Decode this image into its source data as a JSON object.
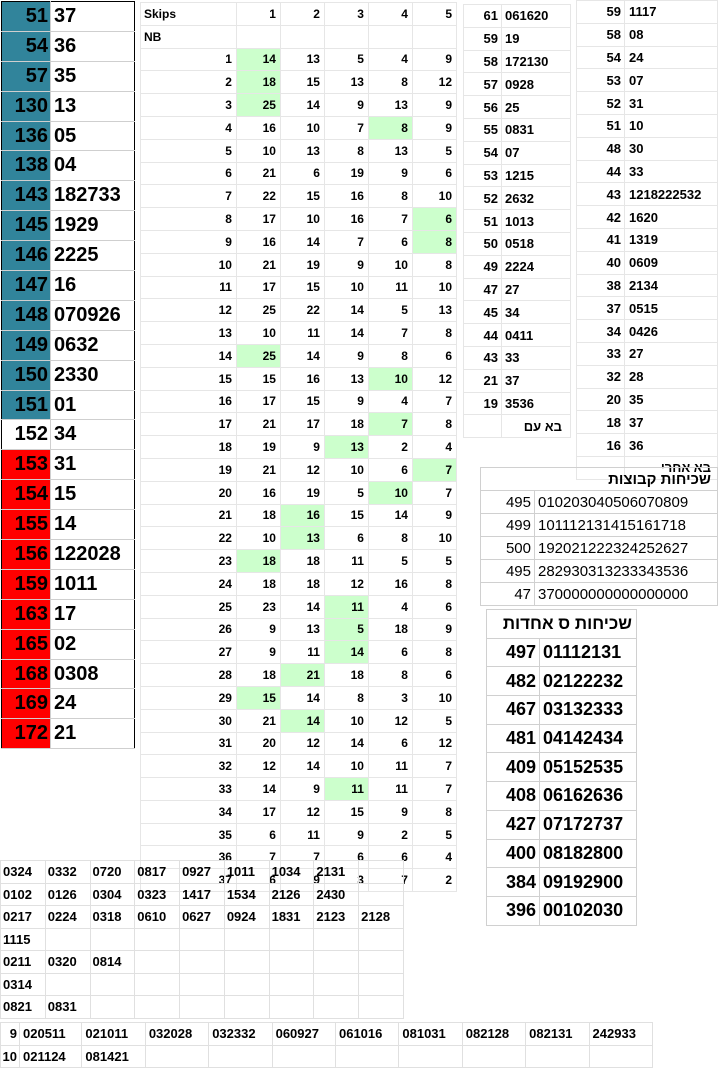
{
  "left_panel": [
    {
      "n": "51",
      "v": "37",
      "c": "blue"
    },
    {
      "n": "54",
      "v": "36",
      "c": "blue"
    },
    {
      "n": "57",
      "v": "35",
      "c": "blue"
    },
    {
      "n": "130",
      "v": "13",
      "c": "blue"
    },
    {
      "n": "136",
      "v": "05",
      "c": "blue"
    },
    {
      "n": "138",
      "v": "04",
      "c": "blue"
    },
    {
      "n": "143",
      "v": "182733",
      "c": "blue"
    },
    {
      "n": "145",
      "v": "1929",
      "c": "blue"
    },
    {
      "n": "146",
      "v": "2225",
      "c": "blue"
    },
    {
      "n": "147",
      "v": "16",
      "c": "blue"
    },
    {
      "n": "148",
      "v": "070926",
      "c": "blue"
    },
    {
      "n": "149",
      "v": "0632",
      "c": "blue"
    },
    {
      "n": "150",
      "v": "2330",
      "c": "blue"
    },
    {
      "n": "151",
      "v": "01",
      "c": "blue"
    },
    {
      "n": "152",
      "v": "34",
      "c": "white"
    },
    {
      "n": "153",
      "v": "31",
      "c": "red"
    },
    {
      "n": "154",
      "v": "15",
      "c": "red"
    },
    {
      "n": "155",
      "v": "14",
      "c": "red"
    },
    {
      "n": "156",
      "v": "122028",
      "c": "red"
    },
    {
      "n": "159",
      "v": "1011",
      "c": "red"
    },
    {
      "n": "163",
      "v": "17",
      "c": "red"
    },
    {
      "n": "165",
      "v": "02",
      "c": "red"
    },
    {
      "n": "168",
      "v": "0308",
      "c": "red"
    },
    {
      "n": "169",
      "v": "24",
      "c": "red"
    },
    {
      "n": "172",
      "v": "21",
      "c": "red"
    }
  ],
  "skips": {
    "header_label": "Skips",
    "nb_label": "NB",
    "columns": [
      "1",
      "2",
      "3",
      "4",
      "5"
    ],
    "rows": [
      {
        "n": "1",
        "v": [
          "14",
          "13",
          "5",
          "4",
          "9"
        ],
        "hl": [
          0
        ]
      },
      {
        "n": "2",
        "v": [
          "18",
          "15",
          "13",
          "8",
          "12"
        ],
        "hl": [
          0
        ]
      },
      {
        "n": "3",
        "v": [
          "25",
          "14",
          "9",
          "13",
          "9"
        ],
        "hl": [
          0
        ]
      },
      {
        "n": "4",
        "v": [
          "16",
          "10",
          "7",
          "8",
          "9"
        ],
        "hl": [
          3
        ]
      },
      {
        "n": "5",
        "v": [
          "10",
          "13",
          "8",
          "13",
          "5"
        ],
        "hl": []
      },
      {
        "n": "6",
        "v": [
          "21",
          "6",
          "19",
          "9",
          "6"
        ],
        "hl": []
      },
      {
        "n": "7",
        "v": [
          "22",
          "15",
          "16",
          "8",
          "10"
        ],
        "hl": []
      },
      {
        "n": "8",
        "v": [
          "17",
          "10",
          "16",
          "7",
          "6"
        ],
        "hl": [
          4
        ]
      },
      {
        "n": "9",
        "v": [
          "16",
          "14",
          "7",
          "6",
          "8"
        ],
        "hl": [
          4
        ]
      },
      {
        "n": "10",
        "v": [
          "21",
          "19",
          "9",
          "10",
          "8"
        ],
        "hl": []
      },
      {
        "n": "11",
        "v": [
          "17",
          "15",
          "10",
          "11",
          "10"
        ],
        "hl": []
      },
      {
        "n": "12",
        "v": [
          "25",
          "22",
          "14",
          "5",
          "13"
        ],
        "hl": []
      },
      {
        "n": "13",
        "v": [
          "10",
          "11",
          "14",
          "7",
          "8"
        ],
        "hl": []
      },
      {
        "n": "14",
        "v": [
          "25",
          "14",
          "9",
          "8",
          "6"
        ],
        "hl": [
          0
        ]
      },
      {
        "n": "15",
        "v": [
          "15",
          "16",
          "13",
          "10",
          "12"
        ],
        "hl": [
          3
        ]
      },
      {
        "n": "16",
        "v": [
          "17",
          "15",
          "9",
          "4",
          "7"
        ],
        "hl": []
      },
      {
        "n": "17",
        "v": [
          "21",
          "17",
          "18",
          "7",
          "8"
        ],
        "hl": [
          3
        ]
      },
      {
        "n": "18",
        "v": [
          "19",
          "9",
          "13",
          "2",
          "4"
        ],
        "hl": [
          2
        ]
      },
      {
        "n": "19",
        "v": [
          "21",
          "12",
          "10",
          "6",
          "7"
        ],
        "hl": [
          4
        ]
      },
      {
        "n": "20",
        "v": [
          "16",
          "19",
          "5",
          "10",
          "7"
        ],
        "hl": [
          3
        ]
      },
      {
        "n": "21",
        "v": [
          "18",
          "16",
          "15",
          "14",
          "9"
        ],
        "hl": [
          1
        ]
      },
      {
        "n": "22",
        "v": [
          "10",
          "13",
          "6",
          "8",
          "10"
        ],
        "hl": [
          1
        ]
      },
      {
        "n": "23",
        "v": [
          "18",
          "18",
          "11",
          "5",
          "5"
        ],
        "hl": [
          0
        ]
      },
      {
        "n": "24",
        "v": [
          "18",
          "18",
          "12",
          "16",
          "8"
        ],
        "hl": []
      },
      {
        "n": "25",
        "v": [
          "23",
          "14",
          "11",
          "4",
          "6"
        ],
        "hl": [
          2
        ]
      },
      {
        "n": "26",
        "v": [
          "9",
          "13",
          "5",
          "18",
          "9"
        ],
        "hl": [
          2
        ]
      },
      {
        "n": "27",
        "v": [
          "9",
          "11",
          "14",
          "6",
          "8"
        ],
        "hl": [
          2
        ]
      },
      {
        "n": "28",
        "v": [
          "18",
          "21",
          "18",
          "8",
          "6"
        ],
        "hl": [
          1
        ]
      },
      {
        "n": "29",
        "v": [
          "15",
          "14",
          "8",
          "3",
          "10"
        ],
        "hl": [
          0
        ]
      },
      {
        "n": "30",
        "v": [
          "21",
          "14",
          "10",
          "12",
          "5"
        ],
        "hl": [
          1
        ]
      },
      {
        "n": "31",
        "v": [
          "20",
          "12",
          "14",
          "6",
          "12"
        ],
        "hl": []
      },
      {
        "n": "32",
        "v": [
          "12",
          "14",
          "10",
          "11",
          "7"
        ],
        "hl": []
      },
      {
        "n": "33",
        "v": [
          "14",
          "9",
          "11",
          "11",
          "7"
        ],
        "hl": [
          2
        ]
      },
      {
        "n": "34",
        "v": [
          "17",
          "12",
          "15",
          "9",
          "8"
        ],
        "hl": []
      },
      {
        "n": "35",
        "v": [
          "6",
          "11",
          "9",
          "2",
          "5"
        ],
        "hl": []
      },
      {
        "n": "36",
        "v": [
          "7",
          "7",
          "6",
          "6",
          "4"
        ],
        "hl": []
      },
      {
        "n": "37",
        "v": [
          "6",
          "9",
          "3",
          "7",
          "2"
        ],
        "hl": []
      }
    ]
  },
  "ba_im": {
    "rows": [
      {
        "n": "61",
        "v": "061620"
      },
      {
        "n": "59",
        "v": "19"
      },
      {
        "n": "58",
        "v": "172130"
      },
      {
        "n": "57",
        "v": "0928"
      },
      {
        "n": "56",
        "v": "25"
      },
      {
        "n": "55",
        "v": "0831"
      },
      {
        "n": "54",
        "v": "07"
      },
      {
        "n": "53",
        "v": "1215"
      },
      {
        "n": "52",
        "v": "2632"
      },
      {
        "n": "51",
        "v": "1013"
      },
      {
        "n": "50",
        "v": "0518"
      },
      {
        "n": "49",
        "v": "2224"
      },
      {
        "n": "47",
        "v": "27"
      },
      {
        "n": "45",
        "v": "34"
      },
      {
        "n": "44",
        "v": "0411"
      },
      {
        "n": "43",
        "v": "33"
      },
      {
        "n": "21",
        "v": "37"
      },
      {
        "n": "19",
        "v": "3536"
      }
    ],
    "label": "בא עם"
  },
  "ba_ahrei": {
    "rows": [
      {
        "n": "59",
        "v": "1117"
      },
      {
        "n": "58",
        "v": "08"
      },
      {
        "n": "54",
        "v": "24"
      },
      {
        "n": "53",
        "v": "07"
      },
      {
        "n": "52",
        "v": "31"
      },
      {
        "n": "51",
        "v": "10"
      },
      {
        "n": "48",
        "v": "30"
      },
      {
        "n": "44",
        "v": "33"
      },
      {
        "n": "43",
        "v": "1218222532"
      },
      {
        "n": "42",
        "v": "1620"
      },
      {
        "n": "41",
        "v": "1319"
      },
      {
        "n": "40",
        "v": "0609"
      },
      {
        "n": "38",
        "v": "2134"
      },
      {
        "n": "37",
        "v": "0515"
      },
      {
        "n": "34",
        "v": "0426"
      },
      {
        "n": "33",
        "v": "27"
      },
      {
        "n": "32",
        "v": "28"
      },
      {
        "n": "20",
        "v": "35"
      },
      {
        "n": "18",
        "v": "37"
      },
      {
        "n": "16",
        "v": "36"
      }
    ],
    "label": "בא אחרי"
  },
  "shchihut_kvutzot": {
    "title": "שכיחות קבוצות",
    "rows": [
      {
        "n": "495",
        "v": "010203040506070809"
      },
      {
        "n": "499",
        "v": "101112131415161718"
      },
      {
        "n": "500",
        "v": "192021222324252627"
      },
      {
        "n": "495",
        "v": "282930313233343536"
      },
      {
        "n": "47",
        "v": "370000000000000000"
      }
    ]
  },
  "shchihut_ahadot": {
    "title": "שכיחות ס אחדות",
    "rows": [
      {
        "n": "497",
        "v": "01112131"
      },
      {
        "n": "482",
        "v": "02122232"
      },
      {
        "n": "467",
        "v": "03132333"
      },
      {
        "n": "481",
        "v": "04142434"
      },
      {
        "n": "409",
        "v": "05152535"
      },
      {
        "n": "408",
        "v": "06162636"
      },
      {
        "n": "427",
        "v": "07172737"
      },
      {
        "n": "400",
        "v": "08182800"
      },
      {
        "n": "384",
        "v": "09192900"
      },
      {
        "n": "396",
        "v": "00102030"
      }
    ]
  },
  "bottom_pairs": [
    [
      "0324",
      "0332",
      "0720",
      "0817",
      "0927",
      "1011",
      "1034",
      "2131",
      ""
    ],
    [
      "0102",
      "0126",
      "0304",
      "0323",
      "1417",
      "1534",
      "2126",
      "2430",
      ""
    ],
    [
      "0217",
      "0224",
      "0318",
      "0610",
      "0627",
      "0924",
      "1831",
      "2123",
      "2128"
    ],
    [
      "1115",
      "",
      "",
      "",
      "",
      "",
      "",
      "",
      ""
    ],
    [
      "0211",
      "0320",
      "0814",
      "",
      "",
      "",
      "",
      "",
      ""
    ],
    [
      "0314",
      "",
      "",
      "",
      "",
      "",
      "",
      "",
      ""
    ],
    [
      "0821",
      "0831",
      "",
      "",
      "",
      "",
      "",
      "",
      ""
    ]
  ],
  "bottom_triples": [
    {
      "n": "9",
      "v": [
        "020511",
        "021011",
        "032028",
        "032332",
        "060927",
        "061016",
        "081031",
        "082128",
        "082131",
        "242933"
      ]
    },
    {
      "n": "10",
      "v": [
        "021124",
        "081421",
        "",
        "",
        "",
        "",
        "",
        "",
        "",
        ""
      ]
    }
  ]
}
